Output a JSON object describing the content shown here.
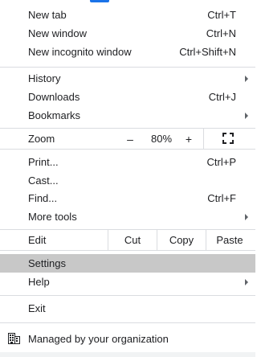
{
  "menu": {
    "new_tab": {
      "label": "New tab",
      "shortcut": "Ctrl+T"
    },
    "new_window": {
      "label": "New window",
      "shortcut": "Ctrl+N"
    },
    "new_incognito": {
      "label": "New incognito window",
      "shortcut": "Ctrl+Shift+N"
    },
    "history": {
      "label": "History"
    },
    "downloads": {
      "label": "Downloads",
      "shortcut": "Ctrl+J"
    },
    "bookmarks": {
      "label": "Bookmarks"
    },
    "zoom": {
      "label": "Zoom",
      "minus": "–",
      "level": "80%",
      "plus": "+"
    },
    "print": {
      "label": "Print...",
      "shortcut": "Ctrl+P"
    },
    "cast": {
      "label": "Cast..."
    },
    "find": {
      "label": "Find...",
      "shortcut": "Ctrl+F"
    },
    "more_tools": {
      "label": "More tools"
    },
    "edit": {
      "label": "Edit",
      "cut": "Cut",
      "copy": "Copy",
      "paste": "Paste"
    },
    "settings": {
      "label": "Settings"
    },
    "help": {
      "label": "Help"
    },
    "exit": {
      "label": "Exit"
    },
    "managed": {
      "label": "Managed by your organization"
    }
  },
  "icons": {
    "submenu": "chevron-right-icon",
    "fullscreen": "fullscreen-icon",
    "managed": "building-icon"
  },
  "colors": {
    "highlight": "#c8c8c8",
    "separator": "#dadce0",
    "text": "#202124",
    "accent": "#1a73e8"
  }
}
